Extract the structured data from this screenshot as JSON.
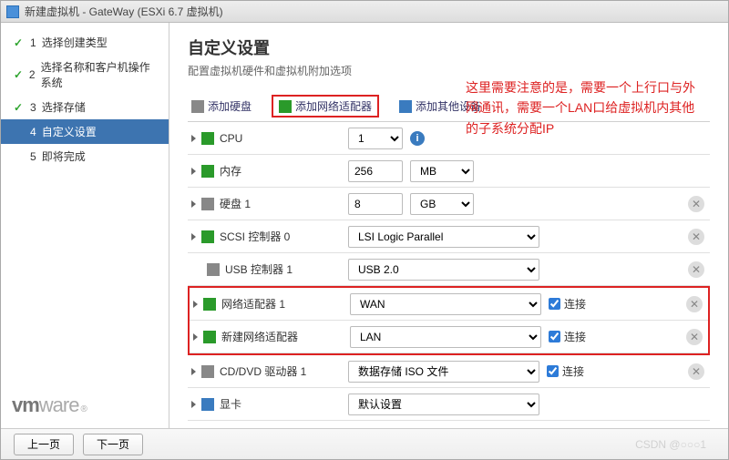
{
  "window": {
    "title": "新建虚拟机 - GateWay (ESXi 6.7 虚拟机)"
  },
  "steps": [
    {
      "num": "1",
      "label": "选择创建类型",
      "state": "done"
    },
    {
      "num": "2",
      "label": "选择名称和客户机操作系统",
      "state": "done"
    },
    {
      "num": "3",
      "label": "选择存储",
      "state": "done"
    },
    {
      "num": "4",
      "label": "自定义设置",
      "state": "current"
    },
    {
      "num": "5",
      "label": "即将完成",
      "state": "pending"
    }
  ],
  "page": {
    "title": "自定义设置",
    "subtitle": "配置虚拟机硬件和虚拟机附加选项"
  },
  "toolbar": {
    "add_disk": "添加硬盘",
    "add_nic": "添加网络适配器",
    "add_other": "添加其他设备"
  },
  "rows": {
    "cpu": {
      "label": "CPU",
      "value": "1"
    },
    "memory": {
      "label": "内存",
      "value": "256",
      "unit": "MB"
    },
    "disk1": {
      "label": "硬盘 1",
      "value": "8",
      "unit": "GB"
    },
    "scsi0": {
      "label": "SCSI 控制器 0",
      "value": "LSI Logic Parallel"
    },
    "usb1": {
      "label": "USB 控制器 1",
      "value": "USB 2.0"
    },
    "nic1": {
      "label": "网络适配器 1",
      "value": "WAN",
      "connect_label": "连接",
      "connected": true
    },
    "nic_new": {
      "label": "新建网络适配器",
      "value": "LAN",
      "connect_label": "连接",
      "connected": true
    },
    "cd1": {
      "label": "CD/DVD 驱动器 1",
      "value": "数据存储 ISO 文件",
      "connect_label": "连接",
      "connected": true
    },
    "video": {
      "label": "显卡",
      "value": "默认设置"
    }
  },
  "annotation": "这里需要注意的是，需要一个上行口与外网通讯，需要一个LAN口给虚拟机内其他的子系统分配IP",
  "footer": {
    "back": "上一页",
    "next": "下一页",
    "watermark": "CSDN @○○○1"
  },
  "logo": {
    "vm": "vm",
    "ware": "ware",
    "reg": "®"
  }
}
